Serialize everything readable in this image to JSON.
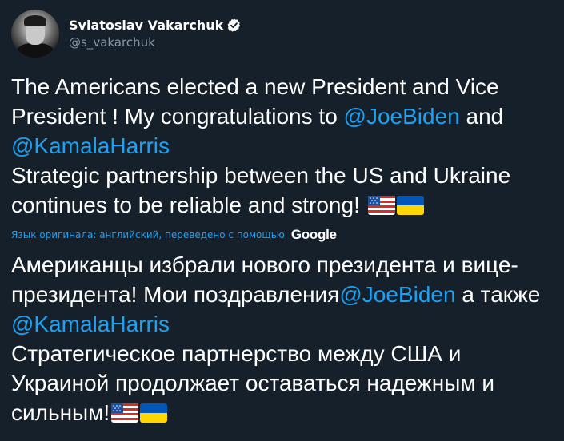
{
  "author": {
    "display_name": "Sviatoslav Vakarchuk",
    "handle": "@s_vakarchuk",
    "verified_icon": "verified-badge-icon"
  },
  "tweet_original": {
    "line1": "The Americans elected a new President and Vice",
    "line2_pre": "President ! My congratulations to ",
    "mention_biden": "@JoeBiden",
    "line2_post": " and",
    "mention_harris": "@KamalaHarris",
    "line4": "Strategic partnership between the US and Ukraine",
    "line5": "continues to be reliable and strong! "
  },
  "translation_note": {
    "text": "Язык оригинала: английский, переведено с помощью",
    "provider": "Google"
  },
  "tweet_translated": {
    "line1": "Американцы избрали нового президента и вице-",
    "line2_pre": "президента! Мои поздравления",
    "mention_biden": "@JoeBiden",
    "line2_post": " а также",
    "mention_harris": "@KamalaHarris",
    "line4": " Стратегическое партнерство между США и",
    "line5": "Украиной продолжает оставаться надежным и",
    "line6": "сильным!"
  },
  "icons": {
    "us_flag": "us-flag-icon",
    "ua_flag": "ukraine-flag-icon"
  },
  "colors": {
    "background": "#15202b",
    "link": "#1da1f2",
    "secondary_text": "#8899a6"
  }
}
